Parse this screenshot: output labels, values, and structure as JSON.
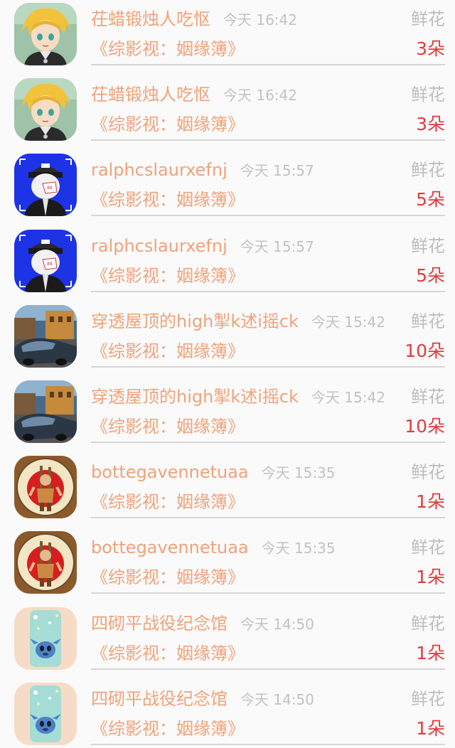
{
  "list": {
    "rows": [
      {
        "username": "茌蜡锻烛人吃怄",
        "time": "今天 16:42",
        "gift": "鲜花",
        "book": "《综影视：姻缘簿》",
        "count": "3朵",
        "avatar_icon": "anime-boy-avatar-icon"
      },
      {
        "username": "茌蜡锻烛人吃怄",
        "time": "今天 16:42",
        "gift": "鲜花",
        "book": "《综影视：姻缘簿》",
        "count": "3朵",
        "avatar_icon": "anime-boy-avatar-icon"
      },
      {
        "username": "ralphcslaurxefnj",
        "time": "今天 15:57",
        "gift": "鲜花",
        "book": "《综影视：姻缘簿》",
        "count": "5朵",
        "avatar_icon": "cap-boy-avatar-icon"
      },
      {
        "username": "ralphcslaurxefnj",
        "time": "今天 15:57",
        "gift": "鲜花",
        "book": "《综影视：姻缘簿》",
        "count": "5朵",
        "avatar_icon": "cap-boy-avatar-icon"
      },
      {
        "username": "穿透屋顶的high掣k述i摇ck",
        "time": "今天 15:42",
        "gift": "鲜花",
        "book": "《综影视：姻缘簿》",
        "count": "10朵",
        "avatar_icon": "car-street-avatar-icon"
      },
      {
        "username": "穿透屋顶的high掣k述i摇ck",
        "time": "今天 15:42",
        "gift": "鲜花",
        "book": "《综影视：姻缘簿》",
        "count": "10朵",
        "avatar_icon": "car-street-avatar-icon"
      },
      {
        "username": "bottegavennetuaa",
        "time": "今天 15:35",
        "gift": "鲜花",
        "book": "《综影视：姻缘簿》",
        "count": "1朵",
        "avatar_icon": "warrior-emblem-avatar-icon"
      },
      {
        "username": "bottegavennetuaa",
        "time": "今天 15:35",
        "gift": "鲜花",
        "book": "《综影视：姻缘簿》",
        "count": "1朵",
        "avatar_icon": "warrior-emblem-avatar-icon"
      },
      {
        "username": "四砌平战役纪念馆",
        "time": "今天 14:50",
        "gift": "鲜花",
        "book": "《综影视：姻缘簿》",
        "count": "1朵",
        "avatar_icon": "stitch-phonecase-avatar-icon"
      },
      {
        "username": "四砌平战役纪念馆",
        "time": "今天 14:50",
        "gift": "鲜花",
        "book": "《综影视：姻缘簿》",
        "count": "1朵",
        "avatar_icon": "stitch-phonecase-avatar-icon"
      }
    ]
  },
  "colors": {
    "username": "#f0a27a",
    "time": "#c2c2c2",
    "gift": "#bdbdbd",
    "count": "#e23b3f",
    "divider": "#d6d6d6",
    "background": "#fafafa"
  }
}
